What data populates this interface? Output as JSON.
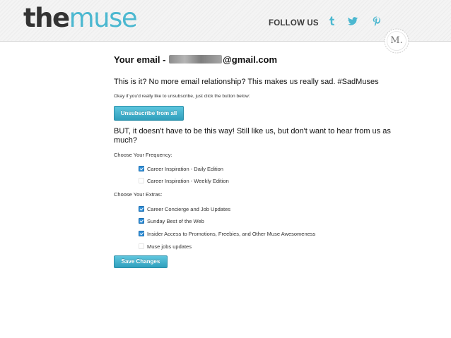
{
  "header": {
    "logo_the": "the",
    "logo_muse": "muse",
    "follow_us": "FOLLOW US",
    "social_icons": [
      "tumblr-icon",
      "twitter-icon",
      "pinterest-icon"
    ],
    "seal_letter": "M."
  },
  "colors": {
    "brand_blue": "#4cb8d0",
    "button_blue": "#3aaed0",
    "checkbox_blue": "#2f8fd8"
  },
  "main": {
    "email_label": "Your email -",
    "email_domain": "@gmail.com",
    "headline": "This is it? No more email relationship? This makes us really sad. #SadMuses",
    "unsubscribe_hint": "Okay if you'd really like to unsubscribe, just click the button below:",
    "unsubscribe_button": "Unsubscribe from all",
    "alternative_text": "BUT, it doesn't have to be this way! Still like us, but don't want to hear from us as much?",
    "frequency_label": "Choose Your Frequency:",
    "frequency_options": [
      {
        "label": "Career Inspiration - Daily Edition",
        "checked": true
      },
      {
        "label": "Career Inspiration - Weekly Edition",
        "checked": false
      }
    ],
    "extras_label": "Choose Your Extras:",
    "extras_options": [
      {
        "label": "Career Concierge and Job Updates",
        "checked": true
      },
      {
        "label": "Sunday Best of the Web",
        "checked": true
      },
      {
        "label": "Insider Access to Promotions, Freebies, and Other Muse Awesomeness",
        "checked": true
      },
      {
        "label": "Muse jobs updates",
        "checked": false
      }
    ],
    "save_button": "Save Changes"
  }
}
